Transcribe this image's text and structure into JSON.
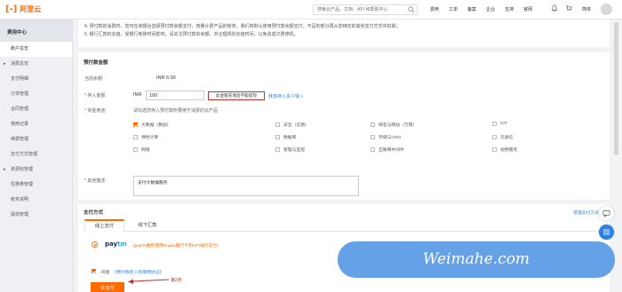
{
  "header": {
    "logo_text": "阿里云",
    "search_placeholder": "搜索云产品、文档、API 和帮助中心",
    "nav": [
      "费用",
      "工单",
      "备案",
      "企业",
      "支持",
      "官网"
    ],
    "lang": "简体"
  },
  "sidebar": {
    "title": "费用中心",
    "items": [
      {
        "label": "账户总览",
        "active": true,
        "group": false
      },
      {
        "label": "消费总览",
        "active": false,
        "group": true
      },
      {
        "label": "支付明细",
        "active": false,
        "group": false
      },
      {
        "label": "订单管理",
        "active": false,
        "group": false
      },
      {
        "label": "合同管理",
        "active": false,
        "group": false
      },
      {
        "label": "使用记录",
        "active": false,
        "group": false
      },
      {
        "label": "续费管理",
        "active": false,
        "group": false
      },
      {
        "label": "支付方式管理",
        "active": false,
        "group": false
      },
      {
        "label": "资源包管理",
        "active": false,
        "group": true
      },
      {
        "label": "优惠券管理",
        "active": false,
        "group": false
      },
      {
        "label": "帐务说明",
        "active": false,
        "group": false
      },
      {
        "label": "提现管理",
        "active": false,
        "group": false
      }
    ]
  },
  "notice": {
    "line1": "4. 预付款的消费时，您可在收银台选择预付款余额支付，按量计费产品的账单，我们将默认使用预付款余额支付，不足的部分再从您绑定的其他支付方式中扣除；",
    "line2": "5. 银行汇款的充值，受银行到账时间影响，请关注预付款的余额，并合理规划充值时间，以免造成欠费停机。"
  },
  "prepaid": {
    "section_title": "预付款金额",
    "balance_label": "当前余额:",
    "balance_value": "INR 6.00",
    "amount_label": "存入金额:",
    "amount_currency": "INR",
    "amount_value": "100",
    "amount_note": "此金额充值后不能提现",
    "amount_link": "我该存入多少钱 »",
    "usage_label": "资金用途:",
    "usage_hint": "请勾选您存入预付款所要用于消费的云产品",
    "desc_label": "其他描述:",
    "desc_value": "支付大数据服务"
  },
  "products": [
    {
      "label": "大数据（数加）",
      "checked": true
    },
    {
      "label": "安全（云盾）",
      "checked": false
    },
    {
      "label": "域名与网站（万网）",
      "checked": false
    },
    {
      "label": "IOT",
      "checked": false
    },
    {
      "label": "弹性计算",
      "checked": false
    },
    {
      "label": "数据库",
      "checked": false
    },
    {
      "label": "存储与CDN",
      "checked": false
    },
    {
      "label": "云通信",
      "checked": false
    },
    {
      "label": "网络",
      "checked": false
    },
    {
      "label": "管理与监控",
      "checked": false
    },
    {
      "label": "互联网中间件",
      "checked": false
    },
    {
      "label": "视频服务",
      "checked": false
    }
  ],
  "payment": {
    "section_title": "支付方式",
    "manage_link": "管理支付方式 »",
    "tabs": [
      "线上支付",
      "线下汇款"
    ],
    "paytm_logo_a": "pay",
    "paytm_logo_b": "tm",
    "paytm_desc": "(paytm推荐使用Rupay银行卡和UPI进行支付)",
    "agree_label": "同意",
    "agree_link": "《预付款存入和使用协议》",
    "pay_button": "去支付",
    "step_label": "第2步"
  },
  "watermark": "Weimahe.com",
  "colors": {
    "brand": "#ff6a00",
    "link": "#2a82e4",
    "alert_red": "#c4302b"
  }
}
